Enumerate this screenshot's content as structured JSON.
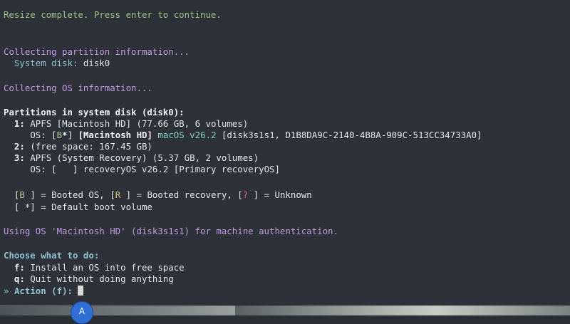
{
  "lines": {
    "resize": "Resize complete. Press enter to continue.",
    "collecting_partition": "Collecting partition information...",
    "system_disk_label": "System disk:",
    "system_disk_value": "disk0",
    "collecting_os": "Collecting OS information...",
    "partitions_header": "Partitions in system disk (disk0):",
    "p1_num": "1:",
    "p1_desc": "APFS [Macintosh HD] (77.66 GB, 6 volumes)",
    "p1_os_label": "OS:",
    "p1_os_bracket_open": "[",
    "p1_os_b": "B",
    "p1_os_star": "*",
    "p1_os_bracket_close": "]",
    "p1_os_name": "[Macintosh HD]",
    "p1_os_version": "macOS v26.2",
    "p1_os_id": "[disk3s1s1, D1B8DA9C-2140-4B8A-909C-513CC34733A0]",
    "p2_num": "2:",
    "p2_desc": "(free space: 167.45 GB)",
    "p3_num": "3:",
    "p3_desc": "APFS (System Recovery) (5.37 GB, 2 volumes)",
    "p3_os_label": "OS:",
    "p3_os_rest": "[   ] recoveryOS v26.2 [Primary recoveryOS]",
    "legend_b_open": "[",
    "legend_b": "B",
    "legend_b_text": " ] = Booted OS, [",
    "legend_r": "R",
    "legend_r_text": " ] = Booted recovery, [",
    "legend_q": "?",
    "legend_q_text": " ] = Unknown",
    "legend_default": "[ *] = Default boot volume",
    "using_os": "Using OS 'Macintosh HD' (disk3s1s1) for machine authentication.",
    "choose": "Choose what to do:",
    "opt_f_key": "f:",
    "opt_f_text": "Install an OS into free space",
    "opt_q_key": "q:",
    "opt_q_text": "Quit without doing anything",
    "prompt_arrow": "»",
    "prompt_text": "Action (f):"
  },
  "badge": {
    "label": "A"
  },
  "colors": {
    "terminal_bg": "#2e3138",
    "green": "#9cc38a",
    "purple": "#c19ce5",
    "cyan": "#8fc4cf",
    "badge_blue": "#2f6fd4"
  }
}
